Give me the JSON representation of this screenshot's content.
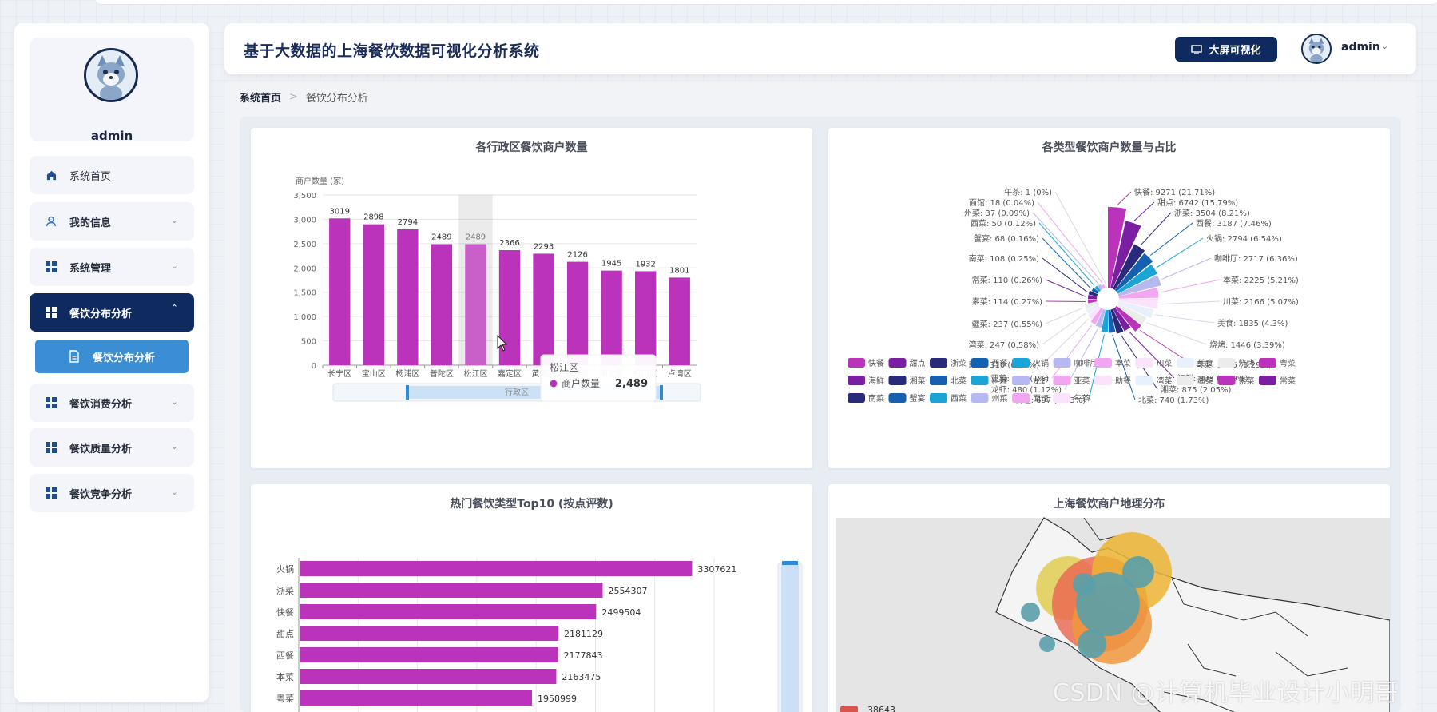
{
  "app": {
    "title": "基于大数据的上海餐饮数据可视化分析系统",
    "bigscreen_label": "大屏可视化",
    "user": "admin"
  },
  "sidebar": {
    "profile_name": "admin",
    "items": [
      {
        "label": "系统首页",
        "icon": "home-icon"
      },
      {
        "label": "我的信息",
        "icon": "user-icon"
      },
      {
        "label": "系统管理",
        "icon": "grid-icon"
      },
      {
        "label": "餐饮分布分析",
        "icon": "grid-icon"
      },
      {
        "label": "餐饮消费分析",
        "icon": "grid-icon"
      },
      {
        "label": "餐饮质量分析",
        "icon": "grid-icon"
      },
      {
        "label": "餐饮竞争分析",
        "icon": "grid-icon"
      }
    ],
    "submenu": {
      "label": "餐饮分布分析",
      "icon": "document-icon"
    }
  },
  "breadcrumb": {
    "home": "系统首页",
    "current": "餐饮分布分析"
  },
  "colors": {
    "accent": "#0f2a5e",
    "bar": "#bb33bb",
    "submenu": "#3b8ed4"
  },
  "watermark": "CSDN @计算机毕业设计小明哥",
  "cards": {
    "district_title": "各行政区餐饮商户数量",
    "type_title": "各类型餐饮商户数量与占比",
    "top10_title": "热门餐饮类型Top10 (按点评数)",
    "map_title": "上海餐饮商户地理分布"
  },
  "chart_data": [
    {
      "type": "bar",
      "title": "各行政区餐饮商户数量",
      "ylabel": "商户数量 (家)",
      "xlabel": "行政区",
      "ylim": [
        0,
        3500
      ],
      "yticks": [
        "0",
        "500",
        "1,000",
        "1,500",
        "2,000",
        "2,500",
        "3,000",
        "3,500"
      ],
      "categories": [
        "长宁区",
        "宝山区",
        "杨浦区",
        "普陀区",
        "松江区",
        "嘉定区",
        "黄浦区",
        "静安区",
        "闸北区",
        "虹口区",
        "卢湾区"
      ],
      "values": [
        3019,
        2898,
        2794,
        2489,
        2489,
        2366,
        2293,
        2126,
        1945,
        1932,
        1801
      ],
      "value_labels": [
        "3019",
        "2898",
        "2794",
        "2489",
        "2489",
        "2366",
        "2293",
        "2126",
        "1945",
        "1932",
        "1801"
      ],
      "highlight_index": 4,
      "tooltip": {
        "title": "松江区",
        "series": "商户数量",
        "value": "2,489"
      },
      "grid": true
    },
    {
      "type": "pie",
      "title": "各类型餐饮商户数量与占比",
      "slices": [
        {
          "name": "快餐",
          "value": 9271,
          "label": "快餐: 9271 (21.71%)",
          "color": "#bb33bb"
        },
        {
          "name": "甜点",
          "value": 6742,
          "label": "甜点: 6742 (15.79%)",
          "color": "#7a1fa2"
        },
        {
          "name": "浙菜",
          "value": 3504,
          "label": "浙菜: 3504 (8.21%)",
          "color": "#2a2a7a"
        },
        {
          "name": "西餐",
          "value": 3187,
          "label": "西餐: 3187 (7.46%)",
          "color": "#1560b0"
        },
        {
          "name": "火锅",
          "value": 2794,
          "label": "火锅: 2794 (6.54%)",
          "color": "#1aa5d6"
        },
        {
          "name": "咖啡厅",
          "value": 2717,
          "label": "咖啡厅: 2717 (6.36%)",
          "color": "#b6b8f2"
        },
        {
          "name": "本菜",
          "value": 2225,
          "label": "本菜: 2225 (5.21%)",
          "color": "#f2a6f2"
        },
        {
          "name": "川菜",
          "value": 2166,
          "label": "川菜: 2166 (5.07%)",
          "color": "#fbe3fb"
        },
        {
          "name": "美食",
          "value": 1835,
          "label": "美食: 1835 (4.3%)",
          "color": "#e8f0fc"
        },
        {
          "name": "烧烤",
          "value": 1446,
          "label": "烧烤: 1446 (3.39%)",
          "color": "#ececec"
        },
        {
          "name": "粤菜",
          "value": 1405,
          "label": "粤菜: 1405 (3.29%)",
          "color": "#bb33bb"
        },
        {
          "name": "海鲜",
          "value": 893,
          "label": "海鲜: 893 (2.09%)",
          "color": "#7a1fa2"
        },
        {
          "name": "湘菜",
          "value": 875,
          "label": "湘菜: 875 (2.05%)",
          "color": "#2a2a7a"
        },
        {
          "name": "北菜",
          "value": 740,
          "label": "北菜: 740 (1.73%)",
          "color": "#1560b0"
        },
        {
          "name": "料理",
          "value": 697,
          "label": "料理: 697 (1.63%)",
          "color": "#1aa5d6"
        },
        {
          "name": "龙虾",
          "value": 480,
          "label": "龙虾: 480 (1.12%)",
          "color": "#b6b8f2"
        },
        {
          "name": "亚菜",
          "value": 426,
          "label": "亚菜: 426 (1%)",
          "color": "#f2a6f2"
        },
        {
          "name": "助餐",
          "value": 310,
          "label": "助餐: 310 (0.73%)",
          "color": "#fbe3fb"
        },
        {
          "name": "湾菜",
          "value": 247,
          "label": "湾菜: 247 (0.58%)",
          "color": "#e8f0fc"
        },
        {
          "name": "疆菜",
          "value": 237,
          "label": "疆菜: 237 (0.55%)",
          "color": "#ececec"
        },
        {
          "name": "素菜",
          "value": 114,
          "label": "素菜: 114 (0.27%)",
          "color": "#bb33bb"
        },
        {
          "name": "常菜",
          "value": 110,
          "label": "常菜: 110 (0.26%)",
          "color": "#7a1fa2"
        },
        {
          "name": "南菜",
          "value": 108,
          "label": "南菜: 108 (0.25%)",
          "color": "#2a2a7a"
        },
        {
          "name": "蟹宴",
          "value": 68,
          "label": "蟹宴: 68 (0.16%)",
          "color": "#1560b0"
        },
        {
          "name": "西菜",
          "value": 50,
          "label": "西菜: 50 (0.12%)",
          "color": "#1aa5d6"
        },
        {
          "name": "州菜",
          "value": 37,
          "label": "州菜: 37 (0.09%)",
          "color": "#b6b8f2"
        },
        {
          "name": "面馆",
          "value": 18,
          "label": "面馆: 18 (0.04%)",
          "color": "#f2a6f2"
        },
        {
          "name": "午茶",
          "value": 1,
          "label": "午茶: 1 (0%)",
          "color": "#fbe3fb"
        }
      ],
      "legend": [
        "快餐",
        "甜点",
        "浙菜",
        "西餐",
        "火锅",
        "咖啡厅",
        "本菜",
        "川菜",
        "美食",
        "烧烤",
        "粤菜",
        "海鲜",
        "湘菜",
        "北菜",
        "料理",
        "龙虾",
        "亚菜",
        "助餐",
        "湾菜",
        "疆菜",
        "素菜",
        "常菜",
        "南菜",
        "蟹宴",
        "西菜",
        "州菜",
        "面馆",
        "午茶"
      ],
      "legend_position": "bottom"
    },
    {
      "type": "bar",
      "orientation": "horizontal",
      "title": "热门餐饮类型Top10 (按点评数)",
      "categories": [
        "火锅",
        "浙菜",
        "快餐",
        "甜点",
        "西餐",
        "本菜",
        "粤菜"
      ],
      "values": [
        3307621,
        2554307,
        2499504,
        2181129,
        2177843,
        2163475,
        1958999
      ],
      "value_labels": [
        "3307621",
        "2554307",
        "2499504",
        "2181129",
        "2177843",
        "2163475",
        "1958999"
      ],
      "xlim": [
        0,
        3500000
      ]
    },
    {
      "type": "scatter",
      "title": "上海餐饮商户地理分布",
      "visual_map_max": "38643"
    }
  ]
}
